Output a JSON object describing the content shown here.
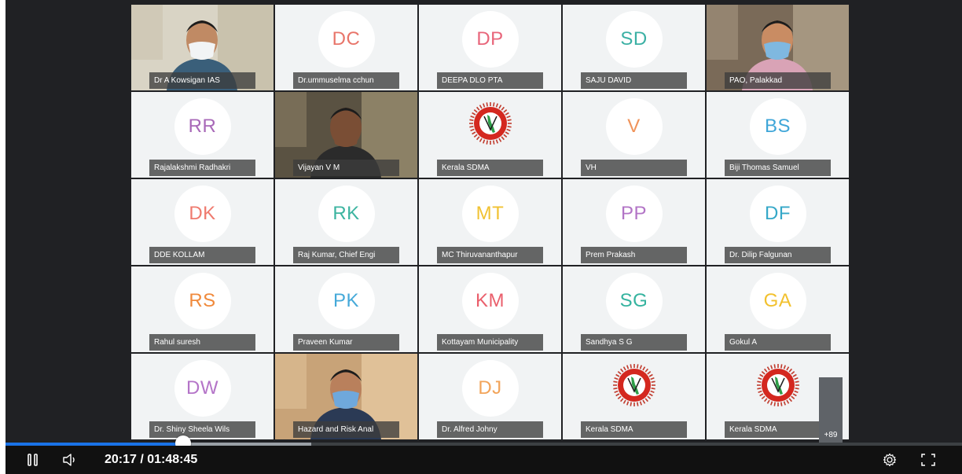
{
  "player": {
    "time_display": "20:17 / 01:48:45",
    "progress_fraction": 0.186,
    "buffered_fraction": 0.32
  },
  "overflow": {
    "label": "+89"
  },
  "tiles": [
    {
      "type": "video",
      "name": "Dr A Kowsigan IAS"
    },
    {
      "type": "initials",
      "initials": "DC",
      "color": "#e8756a",
      "name": "Dr.ummuselma cchun"
    },
    {
      "type": "initials",
      "initials": "DP",
      "color": "#e8657a",
      "name": "DEEPA DLO PTA"
    },
    {
      "type": "initials",
      "initials": "SD",
      "color": "#3bb0a4",
      "name": "SAJU DAVID"
    },
    {
      "type": "video",
      "name": "PAO, Palakkad"
    },
    {
      "type": "initials",
      "initials": "RR",
      "color": "#a869b8",
      "name": "Rajalakshmi Radhakri"
    },
    {
      "type": "video",
      "name": "Vijayan V M"
    },
    {
      "type": "logo",
      "name": "Kerala SDMA"
    },
    {
      "type": "initials",
      "initials": "V",
      "color": "#f0935a",
      "name": "VH"
    },
    {
      "type": "initials",
      "initials": "BS",
      "color": "#3fa6d8",
      "name": "Biji Thomas Samuel"
    },
    {
      "type": "initials",
      "initials": "DK",
      "color": "#ef7a6e",
      "name": "DDE KOLLAM"
    },
    {
      "type": "initials",
      "initials": "RK",
      "color": "#3cb4a0",
      "name": "Raj Kumar, Chief Engi"
    },
    {
      "type": "initials",
      "initials": "MT",
      "color": "#f1c232",
      "name": "MC Thiruvananthapur"
    },
    {
      "type": "initials",
      "initials": "PP",
      "color": "#b274c6",
      "name": "Prem Prakash"
    },
    {
      "type": "initials",
      "initials": "DF",
      "color": "#35a8c8",
      "name": "Dr. Dilip Falgunan"
    },
    {
      "type": "initials",
      "initials": "RS",
      "color": "#f08a3c",
      "name": "Rahul suresh"
    },
    {
      "type": "initials",
      "initials": "PK",
      "color": "#45a9d9",
      "name": "Praveen Kumar"
    },
    {
      "type": "initials",
      "initials": "KM",
      "color": "#ea5f6c",
      "name": "Kottayam Municipality"
    },
    {
      "type": "initials",
      "initials": "SG",
      "color": "#35b39f",
      "name": "Sandhya S G"
    },
    {
      "type": "initials",
      "initials": "GA",
      "color": "#f2c12e",
      "name": "Gokul A"
    },
    {
      "type": "initials",
      "initials": "DW",
      "color": "#b474c8",
      "name": "Dr. Shiny Sheela Wils"
    },
    {
      "type": "video",
      "name": "Hazard and Risk Anal"
    },
    {
      "type": "initials",
      "initials": "DJ",
      "color": "#f2a45a",
      "name": "Dr. Alfred Johny"
    },
    {
      "type": "logo",
      "name": "Kerala SDMA"
    },
    {
      "type": "logo",
      "name": "Kerala SDMA"
    }
  ],
  "icons": {
    "pause": "pause-icon",
    "volume": "volume-icon",
    "settings": "gear-icon",
    "fullscreen": "fullscreen-icon"
  }
}
